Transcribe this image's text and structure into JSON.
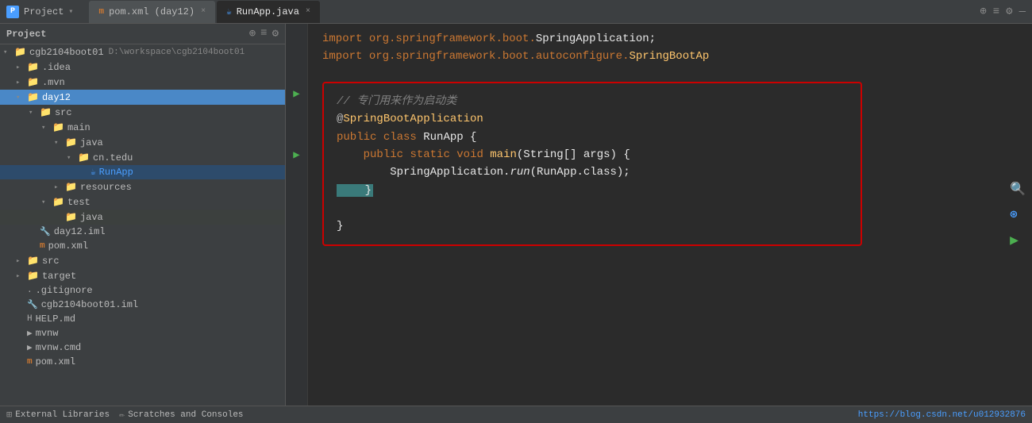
{
  "titleBar": {
    "projectLabel": "Project",
    "dropdownArrow": "▾",
    "icons": [
      "⊕",
      "≡",
      "⚙",
      "—"
    ],
    "tabs": [
      {
        "id": "pom",
        "label": "pom.xml (day12)",
        "iconType": "m",
        "active": false
      },
      {
        "id": "runapp",
        "label": "RunApp.java",
        "iconType": "java",
        "active": true
      }
    ]
  },
  "sidebar": {
    "title": "Project",
    "headerIcons": [
      "⊕",
      "≡",
      "⚙"
    ],
    "tree": [
      {
        "id": "root",
        "label": "cgb2104boot01",
        "path": "D:\\workspace\\cgb2104boot01",
        "indent": 0,
        "arrow": "open",
        "icon": "project"
      },
      {
        "id": "idea",
        "label": ".idea",
        "indent": 1,
        "arrow": "closed",
        "icon": "folder"
      },
      {
        "id": "mvn",
        "label": ".mvn",
        "indent": 1,
        "arrow": "closed",
        "icon": "folder"
      },
      {
        "id": "day12",
        "label": "day12",
        "indent": 1,
        "arrow": "open",
        "icon": "folder",
        "selected": true
      },
      {
        "id": "src1",
        "label": "src",
        "indent": 2,
        "arrow": "open",
        "icon": "folder"
      },
      {
        "id": "main",
        "label": "main",
        "indent": 3,
        "arrow": "open",
        "icon": "folder"
      },
      {
        "id": "java1",
        "label": "java",
        "indent": 4,
        "arrow": "open",
        "icon": "folder-blue"
      },
      {
        "id": "cntedu",
        "label": "cn.tedu",
        "indent": 5,
        "arrow": "open",
        "icon": "folder-blue"
      },
      {
        "id": "runapp",
        "label": "RunApp",
        "indent": 6,
        "arrow": "none",
        "icon": "java-class"
      },
      {
        "id": "resources",
        "label": "resources",
        "indent": 4,
        "arrow": "closed",
        "icon": "folder"
      },
      {
        "id": "test",
        "label": "test",
        "indent": 3,
        "arrow": "open",
        "icon": "folder"
      },
      {
        "id": "java2",
        "label": "java",
        "indent": 4,
        "arrow": "none",
        "icon": "folder-blue"
      },
      {
        "id": "day12iml",
        "label": "day12.iml",
        "indent": 2,
        "arrow": "none",
        "icon": "iml"
      },
      {
        "id": "pomxml1",
        "label": "pom.xml",
        "indent": 2,
        "arrow": "none",
        "icon": "xml"
      },
      {
        "id": "src2",
        "label": "src",
        "indent": 1,
        "arrow": "closed",
        "icon": "folder"
      },
      {
        "id": "target",
        "label": "target",
        "indent": 1,
        "arrow": "closed",
        "icon": "folder-yellow"
      },
      {
        "id": "gitignore",
        "label": ".gitignore",
        "indent": 1,
        "arrow": "none",
        "icon": "gitignore"
      },
      {
        "id": "cgbiml",
        "label": "cgb2104boot01.iml",
        "indent": 1,
        "arrow": "none",
        "icon": "iml"
      },
      {
        "id": "helpmd",
        "label": "HELP.md",
        "indent": 1,
        "arrow": "none",
        "icon": "md"
      },
      {
        "id": "mvnw",
        "label": "mvnw",
        "indent": 1,
        "arrow": "none",
        "icon": "mvnw"
      },
      {
        "id": "mvnwcmd",
        "label": "mvnw.cmd",
        "indent": 1,
        "arrow": "none",
        "icon": "mvnw"
      },
      {
        "id": "pomxml2",
        "label": "pom.xml",
        "indent": 1,
        "arrow": "none",
        "icon": "xml"
      }
    ],
    "externalLibs": "External Libraries",
    "scratches": "Scratches and Consoles"
  },
  "editor": {
    "imports": [
      "import org.springframework.boot.SpringApplication;",
      "import org.springframework.boot.autoconfigure.SpringBootAp"
    ],
    "highlightedCode": [
      {
        "type": "comment",
        "text": "// 专门用来作为启动类"
      },
      {
        "type": "annotation",
        "text": "@SpringBootApplication"
      },
      {
        "type": "class-decl",
        "text": "public class RunApp {"
      },
      {
        "type": "method-decl",
        "text": "    public static void main(String[] args) {"
      },
      {
        "type": "call",
        "text": "        SpringApplication.run(RunApp.class);"
      },
      {
        "type": "close-brace-inner",
        "text": "    }"
      },
      {
        "type": "close-brace-outer",
        "text": "}"
      }
    ]
  },
  "bottomBar": {
    "externalLibsLabel": "External Libraries",
    "scratchesLabel": "Scratches and Consoles",
    "blogUrl": "https://blog.csdn.net/u012932876"
  }
}
